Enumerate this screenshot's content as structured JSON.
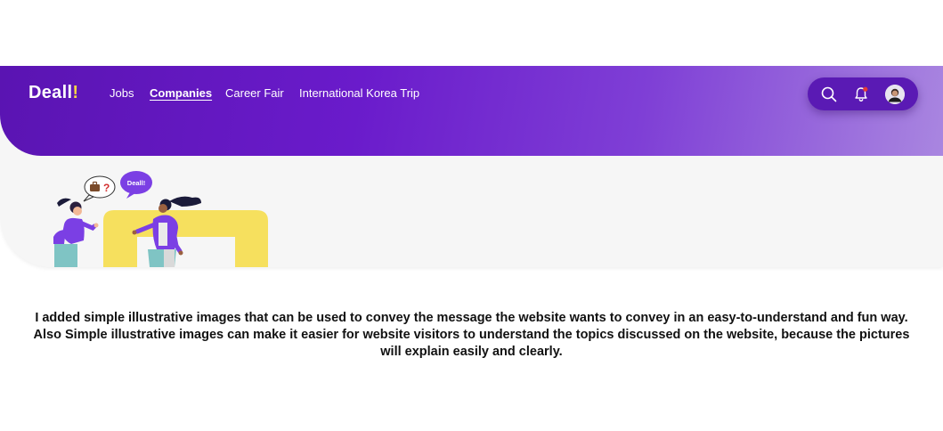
{
  "navbar": {
    "brand": "Deall",
    "brand_mark": "!",
    "links": [
      {
        "label": "Jobs",
        "active": false
      },
      {
        "label": "Companies",
        "active": true
      },
      {
        "label": "Career Fair",
        "active": false
      },
      {
        "label": "International Korea Trip",
        "active": false
      }
    ],
    "actions": {
      "search_icon": "search-icon",
      "notification_icon": "bell-icon",
      "notification_dot_color": "#e53935",
      "avatar_icon": "user-avatar"
    },
    "gradient_colors": [
      "#5a14b2",
      "#6a1bcb",
      "#a986e0"
    ]
  },
  "illustration": {
    "speech_bubble_right": "Deall!",
    "speech_bubble_left_icons": [
      "briefcase-icon",
      "question-mark-icon"
    ],
    "accent_yellow": "#f6e05e",
    "accent_purple": "#7b3fe4"
  },
  "caption": {
    "text": "I added simple illustrative images that can be used to convey the message the website wants to convey in an easy-to-understand and fun way. Also Simple illustrative images can make it easier for website visitors to understand the topics discussed on the website, because the pictures will explain easily and clearly."
  }
}
